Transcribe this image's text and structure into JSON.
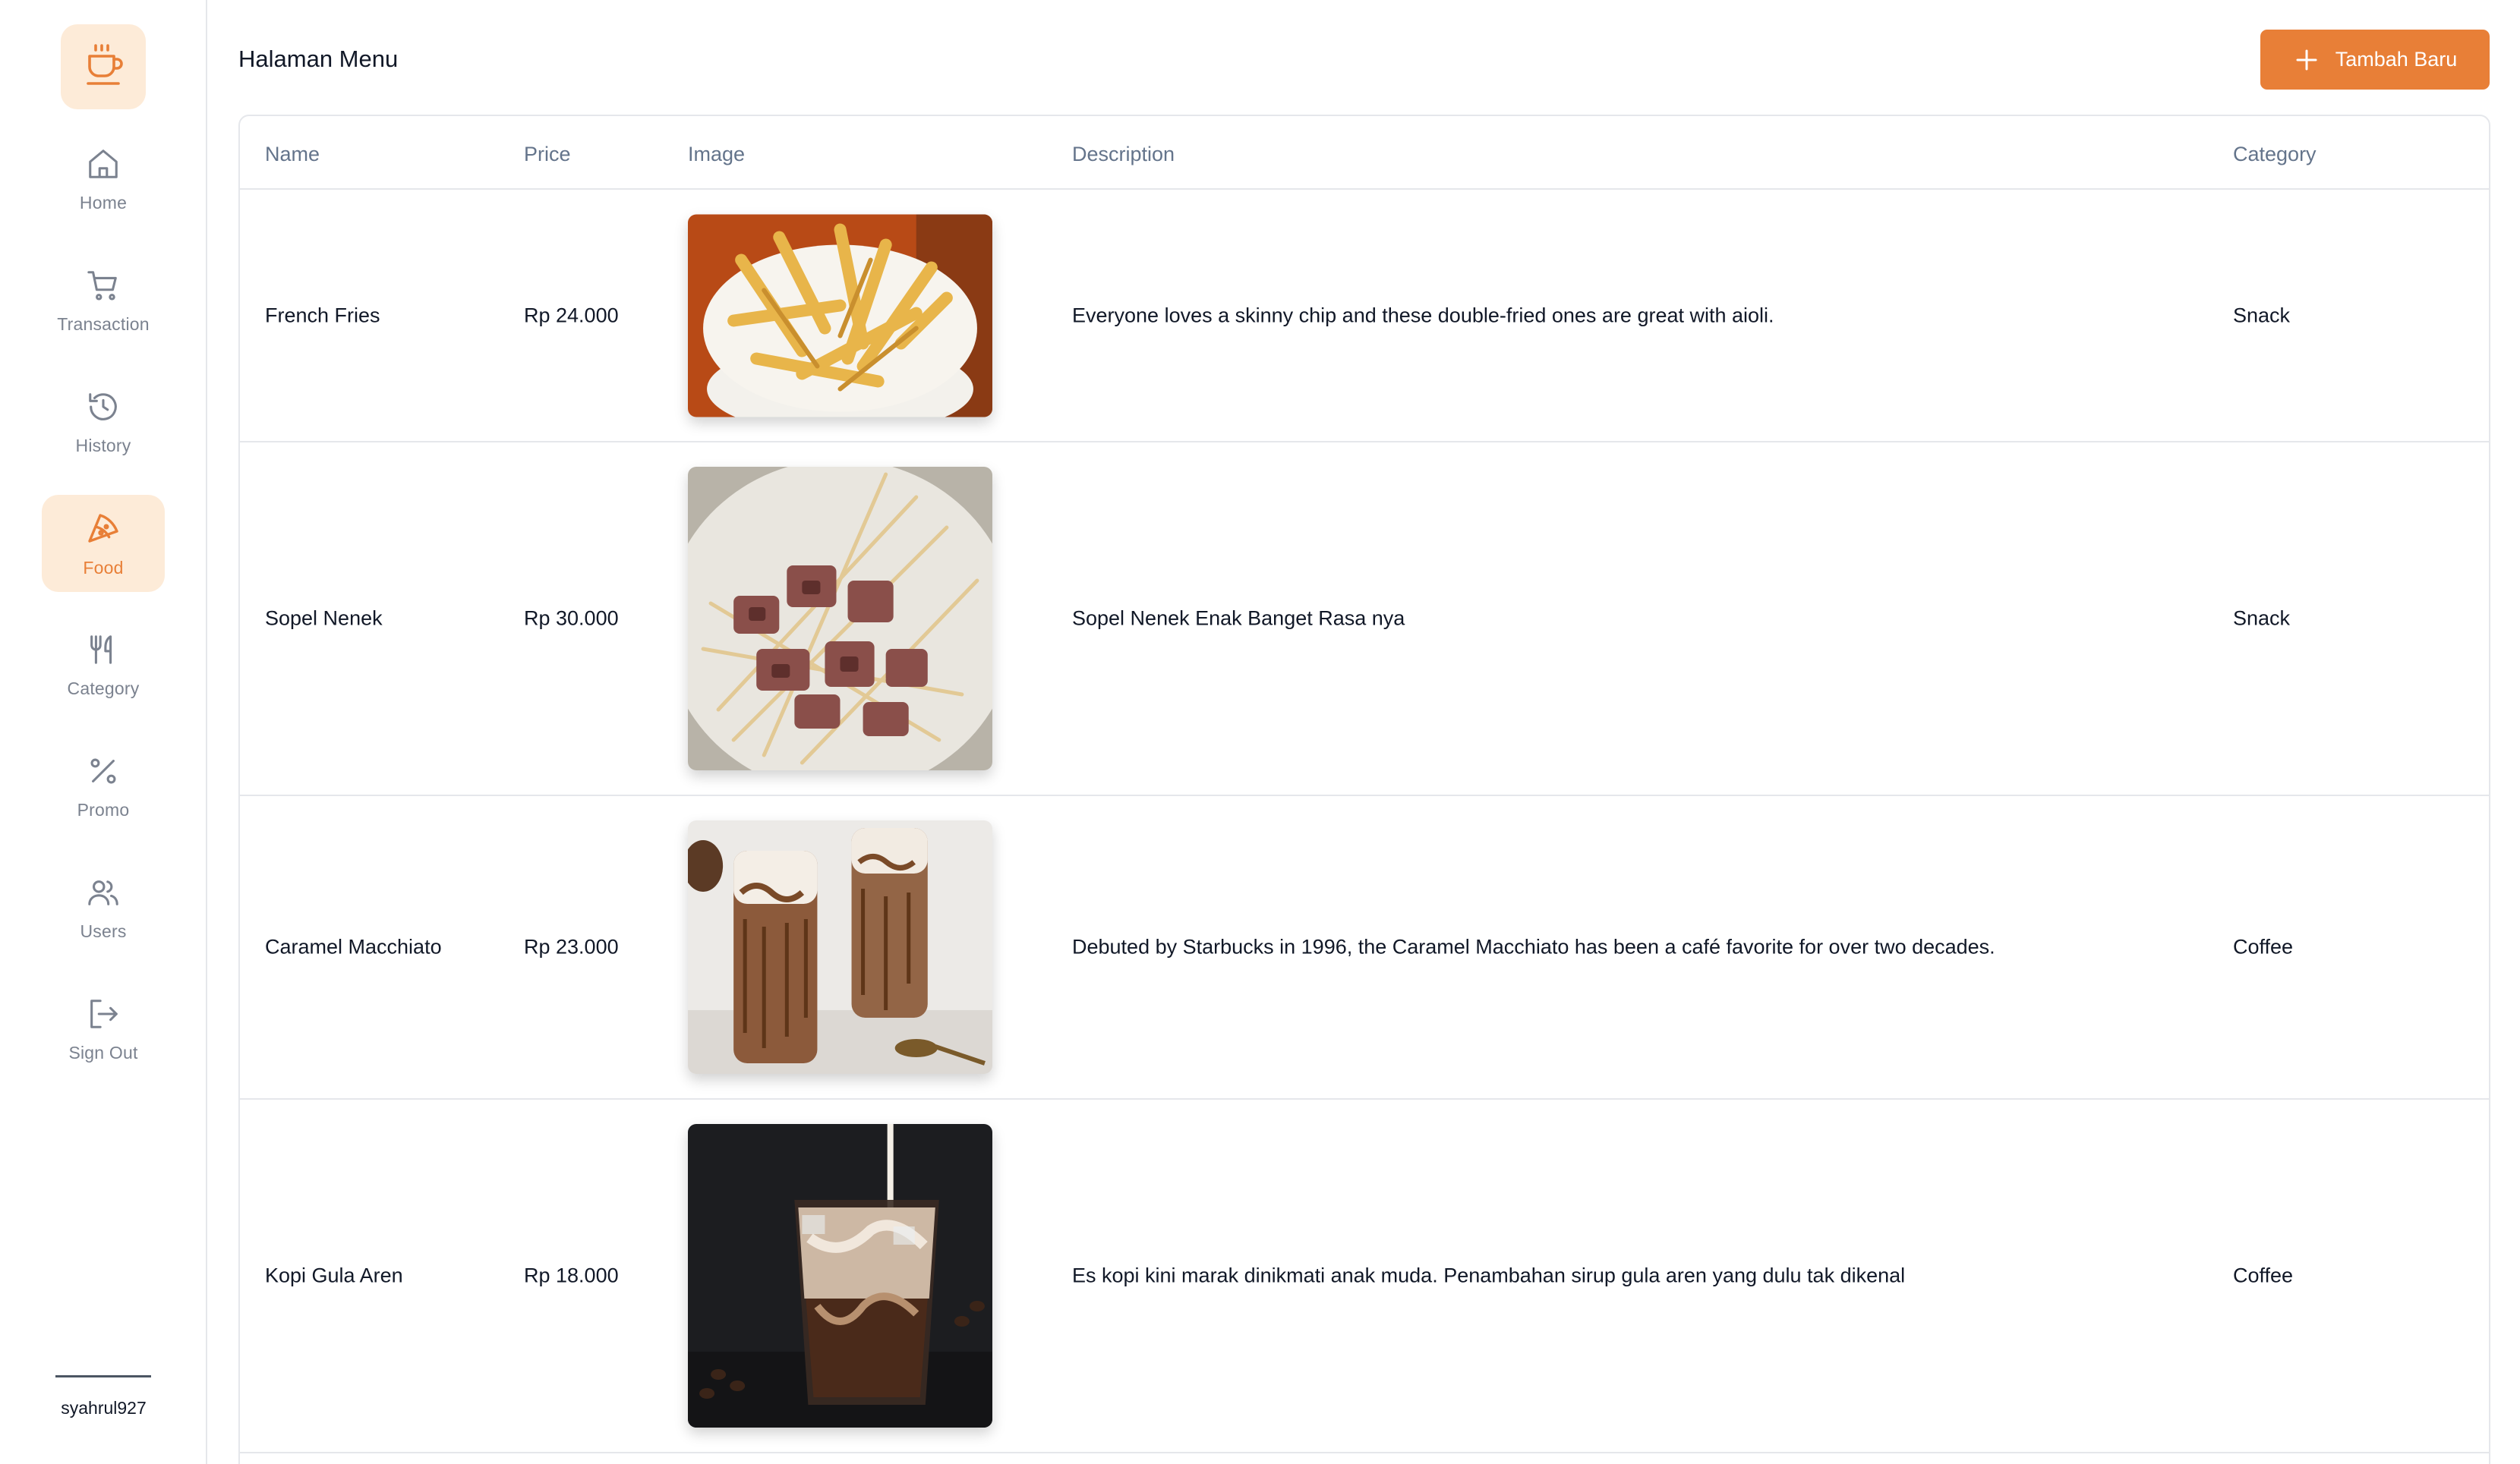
{
  "app": {
    "logo_icon": "coffee-cup-icon",
    "accent_color": "#e87f37",
    "accent_soft_color": "#fdebd8"
  },
  "sidebar": {
    "items": [
      {
        "label": "Home",
        "icon": "home-icon",
        "active": false
      },
      {
        "label": "Transaction",
        "icon": "cart-icon",
        "active": false
      },
      {
        "label": "History",
        "icon": "history-icon",
        "active": false
      },
      {
        "label": "Food",
        "icon": "pizza-slice-icon",
        "active": true
      },
      {
        "label": "Category",
        "icon": "fork-knife-icon",
        "active": false
      },
      {
        "label": "Promo",
        "icon": "percent-icon",
        "active": false
      },
      {
        "label": "Users",
        "icon": "users-icon",
        "active": false
      },
      {
        "label": "Sign Out",
        "icon": "sign-out-icon",
        "active": false
      }
    ],
    "username": "syahrul927"
  },
  "header": {
    "title": "Halaman Menu",
    "add_button_label": "Tambah Baru",
    "add_button_icon": "plus-icon"
  },
  "table": {
    "columns": [
      "Name",
      "Price",
      "Image",
      "Description",
      "Category"
    ],
    "rows": [
      {
        "name": "French Fries",
        "price": "Rp 24.000",
        "image": "french-fries-photo",
        "description": "Everyone loves a skinny chip and these double-fried ones are great with aioli.",
        "category": "Snack"
      },
      {
        "name": "Sopel Nenek",
        "price": "Rp 30.000",
        "image": "satay-skewers-photo",
        "description": "Sopel Nenek Enak Banget Rasa nya",
        "category": "Snack"
      },
      {
        "name": "Caramel Macchiato",
        "price": "Rp 23.000",
        "image": "caramel-macchiato-photo",
        "description": "Debuted by Starbucks in 1996, the Caramel Macchiato has been a café favorite for over two decades.",
        "category": "Coffee"
      },
      {
        "name": "Kopi Gula Aren",
        "price": "Rp 18.000",
        "image": "iced-palm-sugar-coffee-photo",
        "description": "Es kopi kini marak dinikmati anak muda. Penambahan sirup gula aren yang dulu tak dikenal",
        "category": "Coffee"
      }
    ],
    "row_action_icon": "more-horizontal-icon"
  }
}
